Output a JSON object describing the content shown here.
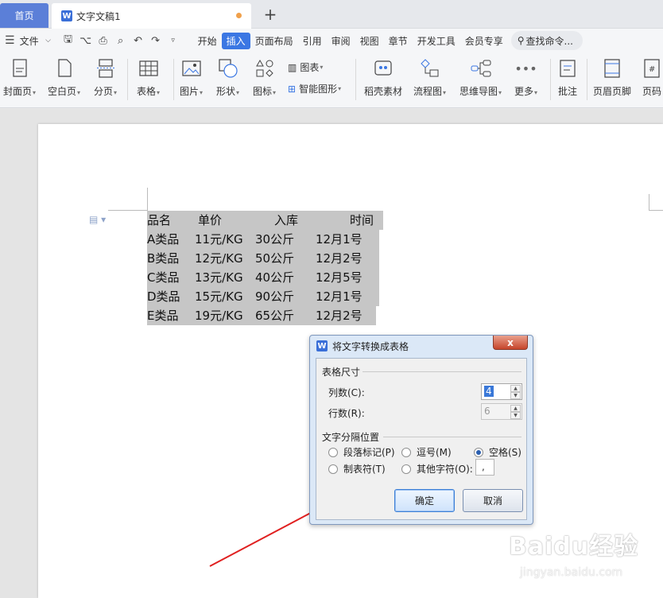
{
  "tabs": {
    "home": "首页",
    "doc_title": "文字文稿1"
  },
  "menu": {
    "file": "文件",
    "items": [
      "开始",
      "插入",
      "页面布局",
      "引用",
      "审阅",
      "视图",
      "章节",
      "开发工具",
      "会员专享"
    ],
    "active": "插入",
    "search": "查找命令..."
  },
  "ribbon": {
    "cover": "封面页",
    "blank": "空白页",
    "page_break": "分页",
    "table": "表格",
    "picture": "图片",
    "shape": "形状",
    "icon": "图标",
    "chart": "图表",
    "smart_art": "智能图形",
    "docer": "稻壳素材",
    "flowchart": "流程图",
    "mindmap": "思维导图",
    "more": "更多",
    "comment": "批注",
    "header_footer": "页眉页脚",
    "page_number": "页码"
  },
  "document": {
    "rows": [
      [
        "品名",
        "单价",
        "入库",
        "时间"
      ],
      [
        "A类品",
        "11元/KG",
        "30公斤",
        "12月1号"
      ],
      [
        "B类品",
        "12元/KG",
        "50公斤",
        "12月2号"
      ],
      [
        "C类品",
        "13元/KG",
        "40公斤",
        "12月5号"
      ],
      [
        "D类品",
        "15元/KG",
        "90公斤",
        "12月1号"
      ],
      [
        "E类品",
        "19元/KG",
        "65公斤",
        "12月2号"
      ]
    ]
  },
  "dialog": {
    "title": "将文字转换成表格",
    "close": "x",
    "size_group": "表格尺寸",
    "columns_label": "列数(C):",
    "columns_value": "4",
    "rows_label": "行数(R):",
    "rows_value": "6",
    "separator_group": "文字分隔位置",
    "opt_paragraph": "段落标记(P)",
    "opt_comma": "逗号(M)",
    "opt_space": "空格(S)",
    "opt_tab": "制表符(T)",
    "opt_other": "其他字符(O):",
    "other_value": ",",
    "selected_option": "空格(S)",
    "ok": "确定",
    "cancel": "取消"
  },
  "watermark": {
    "brand": "Baidu经验",
    "url": "jingyan.baidu.com"
  },
  "colors": {
    "accent": "#3b77e3",
    "home_tab": "#5b7fd8",
    "highlight": "#c6c6c6",
    "arrow": "#e02020"
  }
}
